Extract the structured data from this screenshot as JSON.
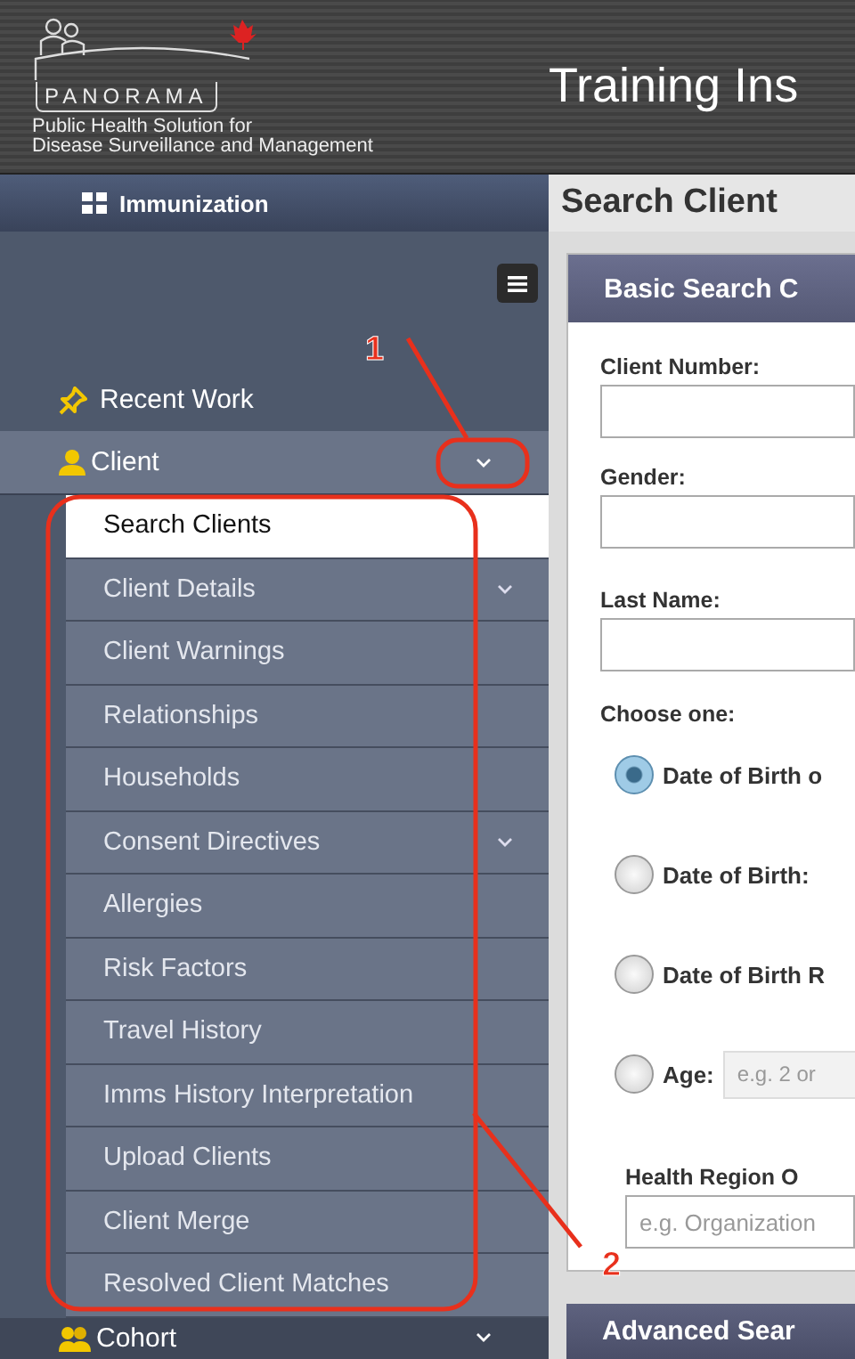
{
  "header": {
    "logo_word": "PANORAMA",
    "logo_subtitle": [
      "Public Health Solution for",
      "Disease Surveillance and Management"
    ],
    "title": "Training Ins"
  },
  "sidebar": {
    "module": "Immunization",
    "items": [
      {
        "kind": "link",
        "label": "Recent Work"
      },
      {
        "kind": "group",
        "label": "Client",
        "expanded": true,
        "children": [
          {
            "label": "Search Clients",
            "selected": true,
            "expandable": false
          },
          {
            "label": "Client Details",
            "selected": false,
            "expandable": true
          },
          {
            "label": "Client Warnings",
            "selected": false,
            "expandable": false
          },
          {
            "label": "Relationships",
            "selected": false,
            "expandable": false
          },
          {
            "label": "Households",
            "selected": false,
            "expandable": false
          },
          {
            "label": "Consent Directives",
            "selected": false,
            "expandable": true
          },
          {
            "label": "Allergies",
            "selected": false,
            "expandable": false
          },
          {
            "label": "Risk Factors",
            "selected": false,
            "expandable": false
          },
          {
            "label": "Travel History",
            "selected": false,
            "expandable": false
          },
          {
            "label": "Imms History Interpretation",
            "selected": false,
            "expandable": false
          },
          {
            "label": "Upload Clients",
            "selected": false,
            "expandable": false
          },
          {
            "label": "Client Merge",
            "selected": false,
            "expandable": false
          },
          {
            "label": "Resolved Client Matches",
            "selected": false,
            "expandable": false
          }
        ]
      },
      {
        "kind": "group",
        "label": "Cohort",
        "expanded": false
      }
    ]
  },
  "main": {
    "title": "Search Client",
    "section_title": "Basic Search C",
    "form": [
      {
        "kind": "text",
        "label": "Client Number:"
      },
      {
        "kind": "text",
        "label": "Gender:"
      },
      {
        "kind": "text",
        "label": "Last Name:"
      },
      {
        "kind": "heading",
        "label": "Choose one:"
      },
      {
        "kind": "radio",
        "label": "Date of Birth o",
        "selected": true
      },
      {
        "kind": "radio",
        "label": "Date of Birth:",
        "selected": false
      },
      {
        "kind": "radio",
        "label": "Date of Birth R",
        "selected": false
      },
      {
        "kind": "radio",
        "label": "Age:",
        "selected": false,
        "placeholder": "e.g. 2 or"
      },
      {
        "kind": "text",
        "label": "Health Region O",
        "placeholder": "e.g. Organization"
      }
    ],
    "advanced_title": "Advanced Sear"
  },
  "annotations": [
    {
      "label": "1"
    },
    {
      "label": "2"
    }
  ]
}
